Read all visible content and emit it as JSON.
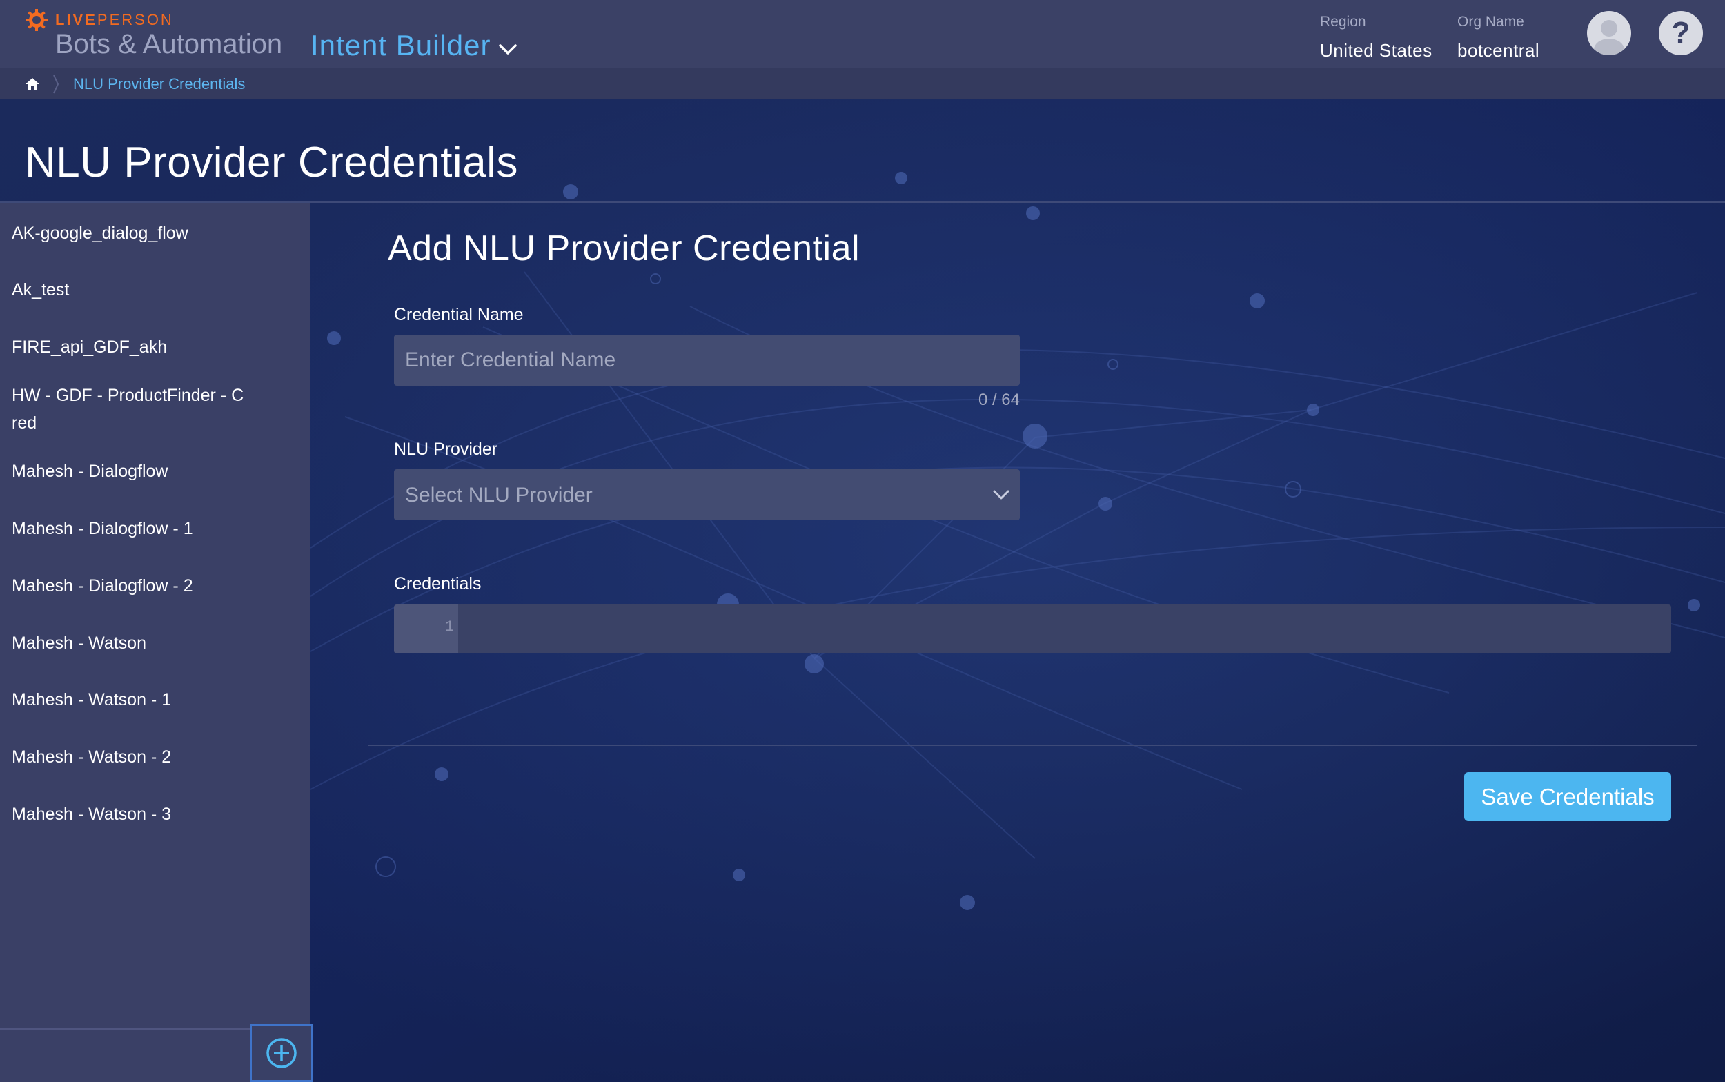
{
  "header": {
    "brand": "LIVEPERSON",
    "brand_prefix": "LIVE",
    "brand_suffix": "PERSON",
    "app_name": "Bots & Automation",
    "module": "Intent Builder",
    "region_label": "Region",
    "region_value": "United States",
    "org_label": "Org Name",
    "org_value": "botcentral",
    "help_glyph": "?"
  },
  "breadcrumb": {
    "items": [
      "NLU Provider Credentials"
    ]
  },
  "page": {
    "title": "NLU Provider Credentials"
  },
  "sidebar": {
    "items": [
      "AK-google_dialog_flow",
      "Ak_test",
      "FIRE_api_GDF_akh",
      "HW - GDF - ProductFinder - C",
      "red",
      "Mahesh - Dialogflow",
      "Mahesh - Dialogflow - 1",
      "Mahesh - Dialogflow - 2",
      "Mahesh - Watson",
      "Mahesh - Watson - 1",
      "Mahesh - Watson - 2",
      "Mahesh - Watson - 3"
    ]
  },
  "form": {
    "title": "Add NLU Provider Credential",
    "credential_name_label": "Credential Name",
    "credential_name_placeholder": "Enter Credential Name",
    "credential_name_value": "",
    "counter": "0 / 64",
    "nlu_provider_label": "NLU Provider",
    "nlu_provider_selected": "Select NLU Provider",
    "credentials_label": "Credentials",
    "line_number": "1",
    "save_label": "Save Credentials"
  },
  "colors": {
    "brand_orange": "#f26b21",
    "accent_blue": "#4cb6f0",
    "header_bg": "#3b4166",
    "page_bg": "#16244f",
    "sidebar_bg": "#3a4066"
  },
  "icons": {
    "logo": "liveperson-logo-icon",
    "module_dropdown": "chevron-down-icon",
    "avatar": "user-avatar-icon",
    "help": "help-icon",
    "home": "home-icon",
    "select_dropdown": "chevron-down-icon",
    "add": "plus-circle-icon"
  }
}
